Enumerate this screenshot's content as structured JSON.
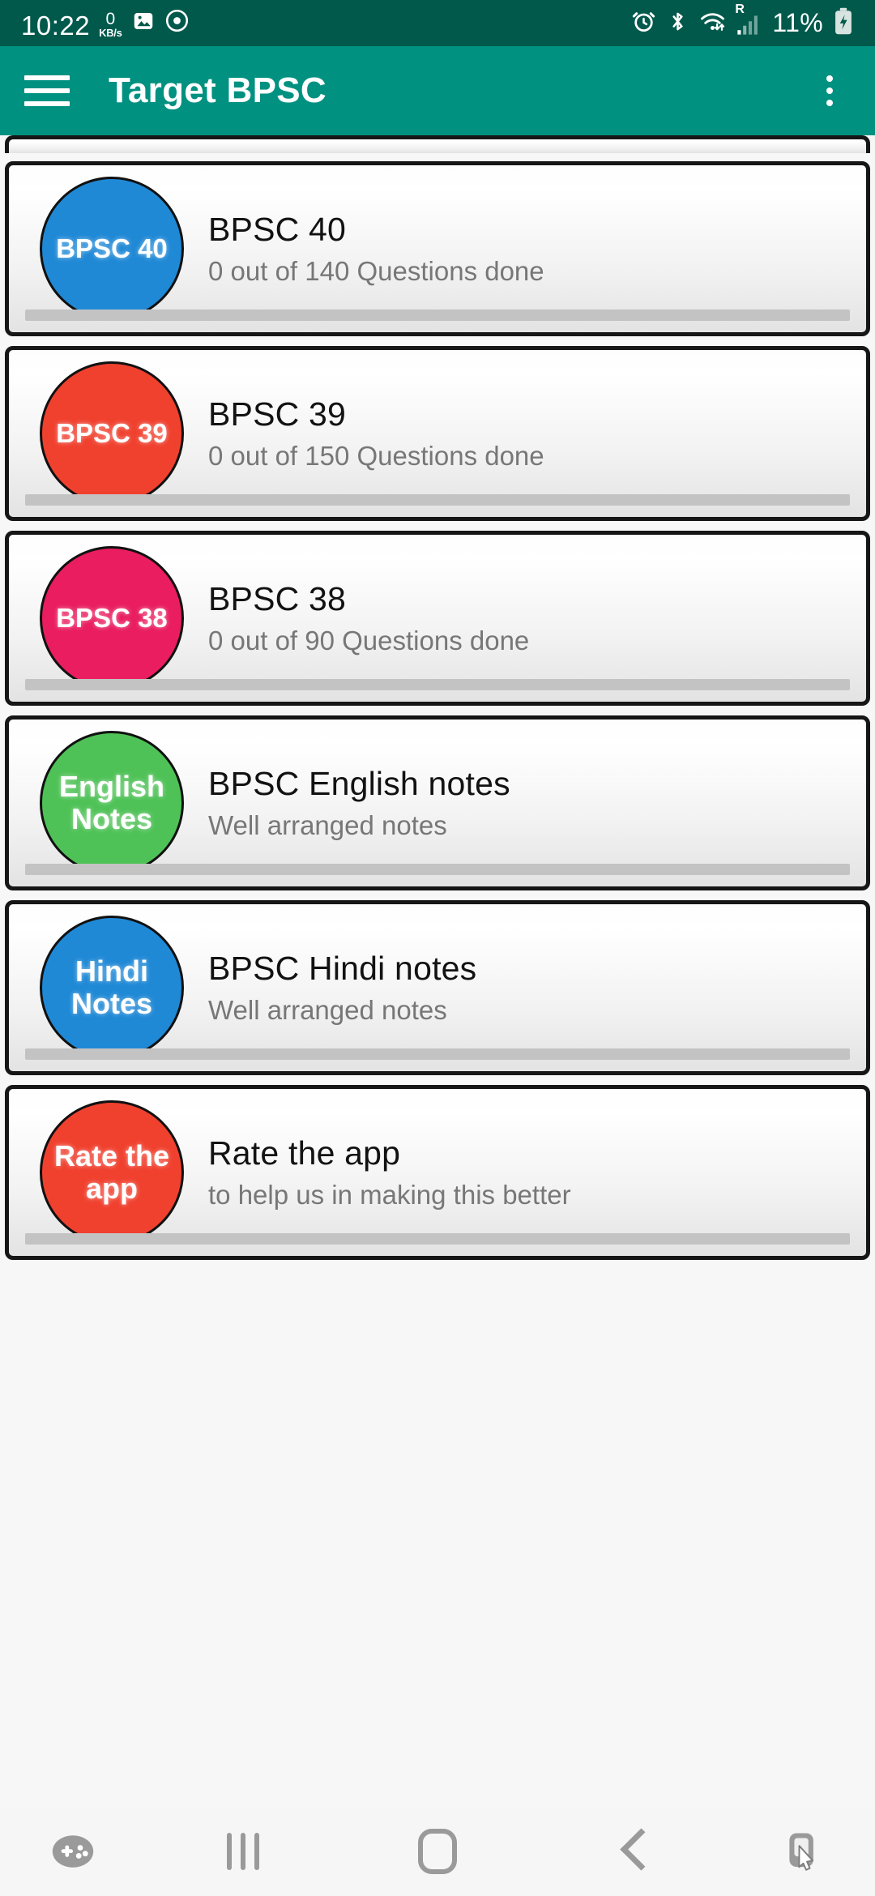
{
  "status_bar": {
    "time": "10:22",
    "net_speed_value": "0",
    "net_speed_unit": "KB/s",
    "battery_percent": "11%",
    "icons": [
      "photo-icon",
      "screen-record-icon",
      "alarm-icon",
      "bluetooth-icon",
      "wifi-icon",
      "roaming-signal-icon",
      "battery-charging-icon"
    ],
    "roaming_label": "R",
    "background_color": "#00594b"
  },
  "app_bar": {
    "title": "Target BPSC",
    "menu_icon": "hamburger-icon",
    "overflow_icon": "kebab-menu-icon",
    "background_color": "#019181"
  },
  "list": {
    "items": [
      {
        "badge_text": "BPSC 40",
        "badge_lines": [
          "BPSC 40"
        ],
        "badge_color": "#2089d6",
        "title": "BPSC 40",
        "subtitle": "0 out of 140 Questions done",
        "questions_done": 0,
        "questions_total": 140
      },
      {
        "badge_text": "BPSC 39",
        "badge_lines": [
          "BPSC 39"
        ],
        "badge_color": "#f0412f",
        "title": "BPSC 39",
        "subtitle": "0 out of 150 Questions done",
        "questions_done": 0,
        "questions_total": 150
      },
      {
        "badge_text": "BPSC 38",
        "badge_lines": [
          "BPSC 38"
        ],
        "badge_color": "#e91d5f",
        "title": "BPSC 38",
        "subtitle": "0 out of 90 Questions done",
        "questions_done": 0,
        "questions_total": 90
      },
      {
        "badge_text": "English Notes",
        "badge_lines": [
          "English",
          "Notes"
        ],
        "badge_color": "#4fc257",
        "title": "BPSC English notes",
        "subtitle": "Well arranged notes"
      },
      {
        "badge_text": "Hindi Notes",
        "badge_lines": [
          "Hindi",
          "Notes"
        ],
        "badge_color": "#2089d6",
        "title": "BPSC Hindi notes",
        "subtitle": "Well arranged notes"
      },
      {
        "badge_text": "Rate the app",
        "badge_lines": [
          "Rate the",
          "app"
        ],
        "badge_color": "#f0412f",
        "title": "Rate the app",
        "subtitle": "to help us in making this better"
      }
    ]
  },
  "nav_bar": {
    "buttons": [
      "game-launcher-icon",
      "recents-icon",
      "home-icon",
      "back-icon",
      "screen-pointer-icon"
    ],
    "background_color": "#f6f6f6"
  }
}
